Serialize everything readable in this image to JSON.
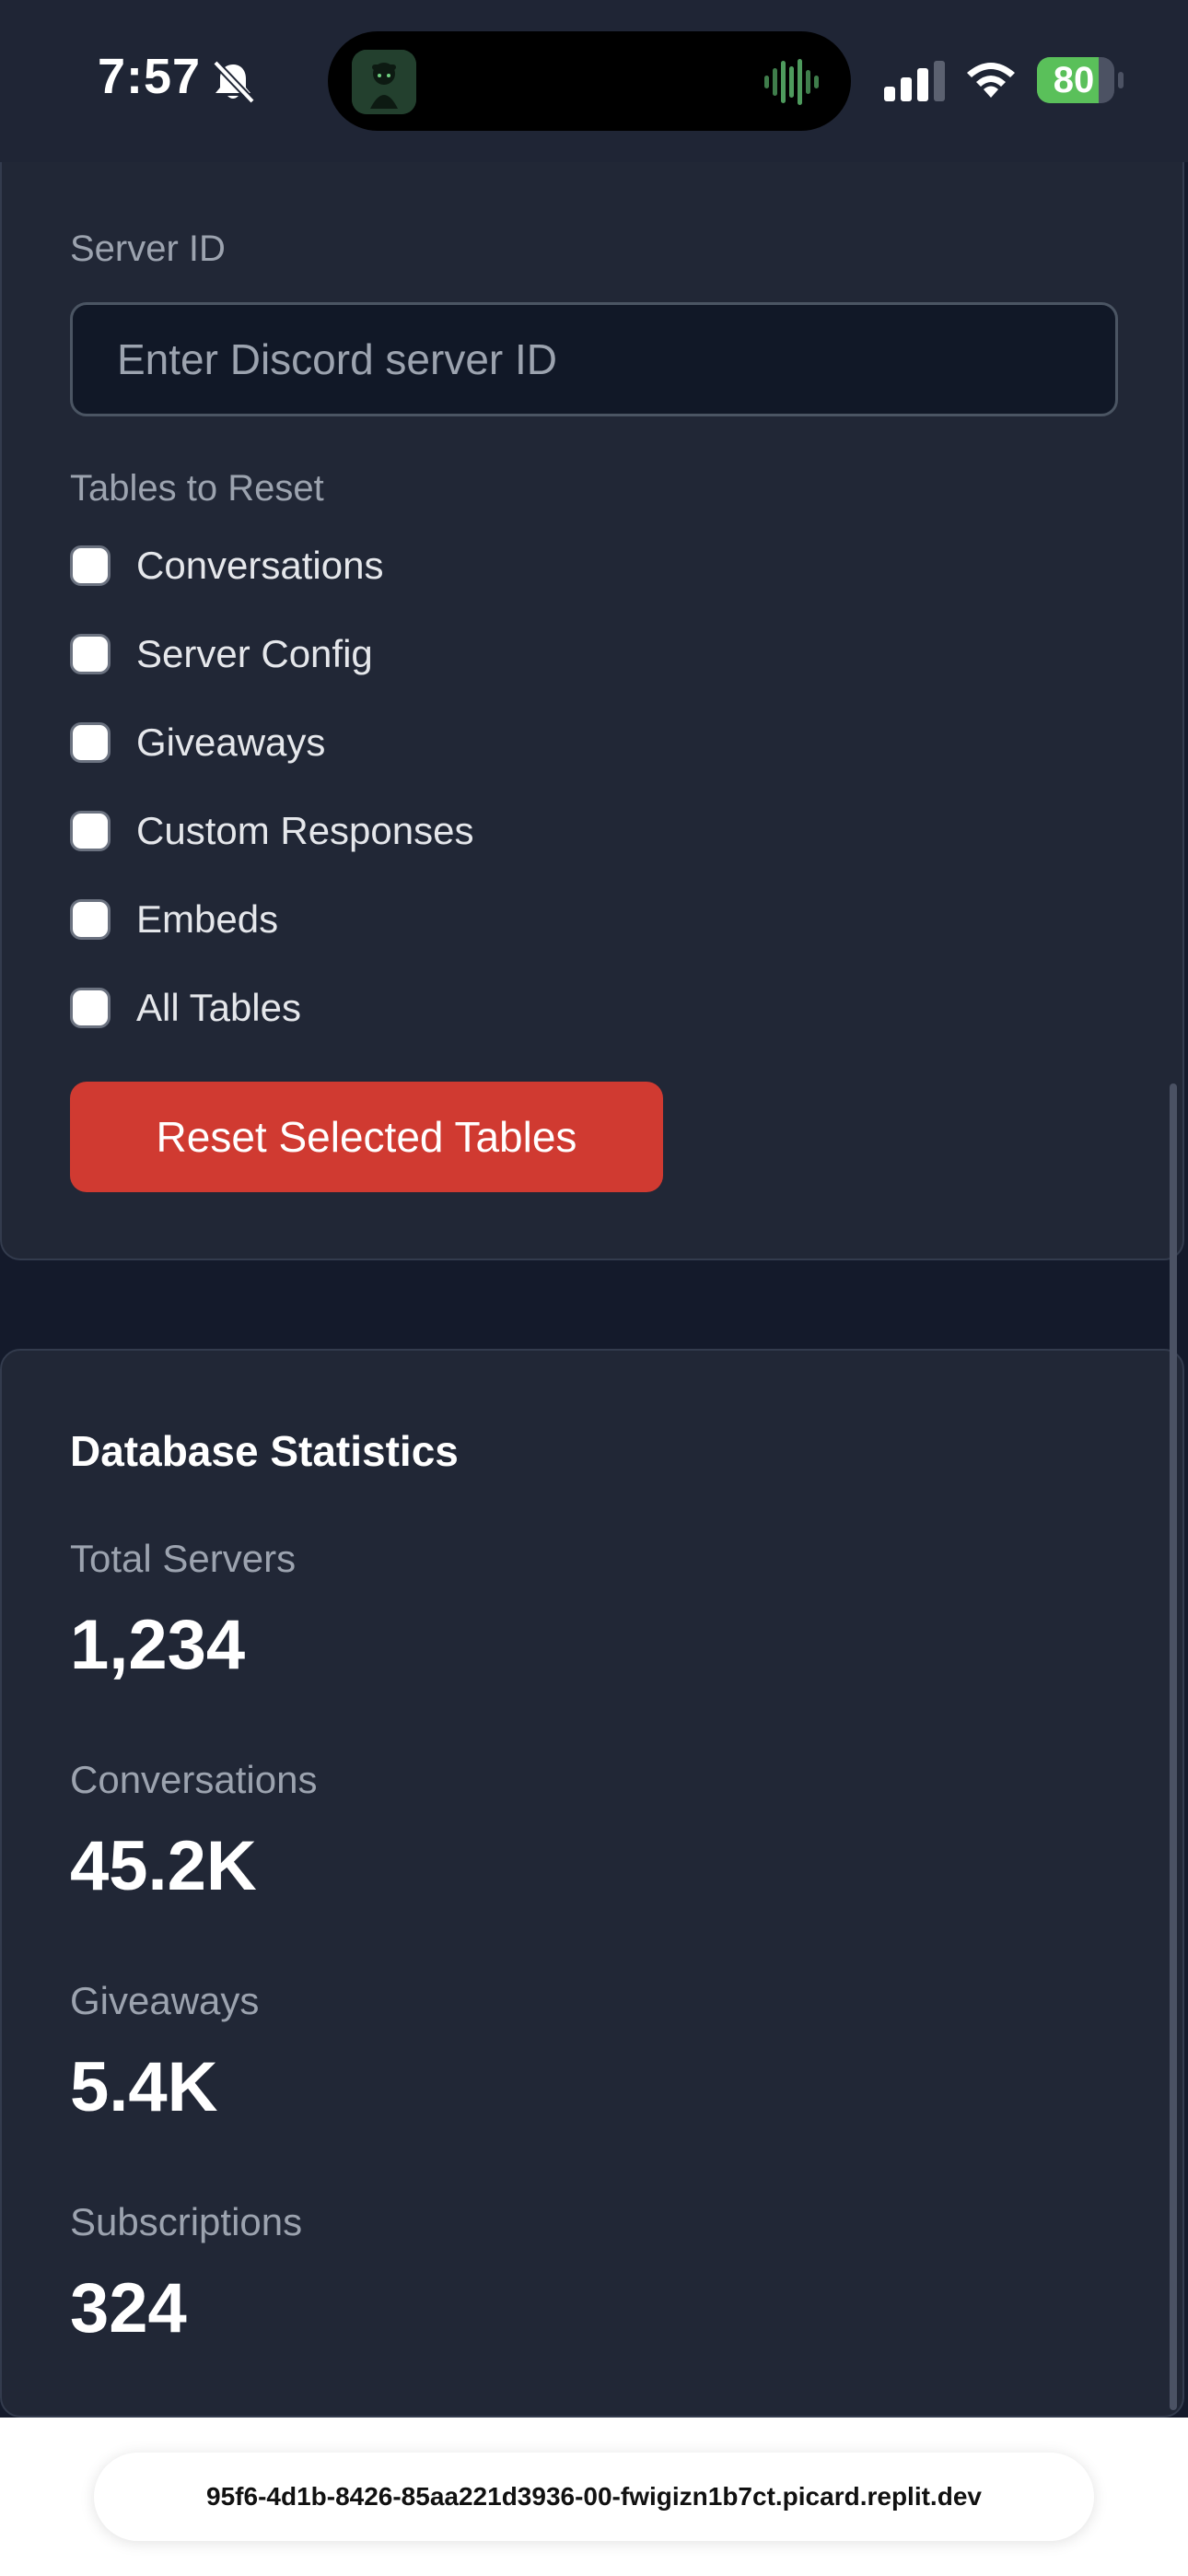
{
  "status_bar": {
    "time": "7:57",
    "battery": "80",
    "battery_level": 0.8,
    "icons": [
      "bell-slash-icon",
      "signal-icon",
      "wifi-icon",
      "battery-icon"
    ]
  },
  "reset_section": {
    "server_id_label": "Server ID",
    "server_id_value": "",
    "server_id_placeholder": "Enter Discord server ID",
    "tables_label": "Tables to Reset",
    "tables": [
      {
        "label": "Conversations",
        "checked": false
      },
      {
        "label": "Server Config",
        "checked": false
      },
      {
        "label": "Giveaways",
        "checked": false
      },
      {
        "label": "Custom Responses",
        "checked": false
      },
      {
        "label": "Embeds",
        "checked": false
      },
      {
        "label": "All Tables",
        "checked": false
      }
    ],
    "reset_button": "Reset Selected Tables"
  },
  "stats": {
    "title": "Database Statistics",
    "items": [
      {
        "label": "Total Servers",
        "value": "1,234"
      },
      {
        "label": "Conversations",
        "value": "45.2K"
      },
      {
        "label": "Giveaways",
        "value": "5.4K"
      },
      {
        "label": "Subscriptions",
        "value": "324"
      }
    ]
  },
  "browser": {
    "url": "95f6-4d1b-8426-85aa221d3936-00-fwigizn1b7ct.picard.replit.dev"
  },
  "colors": {
    "page_bg": "#141a2b",
    "card_bg": "#212736",
    "danger": "#d03a31",
    "battery_green": "#5ac05a"
  }
}
